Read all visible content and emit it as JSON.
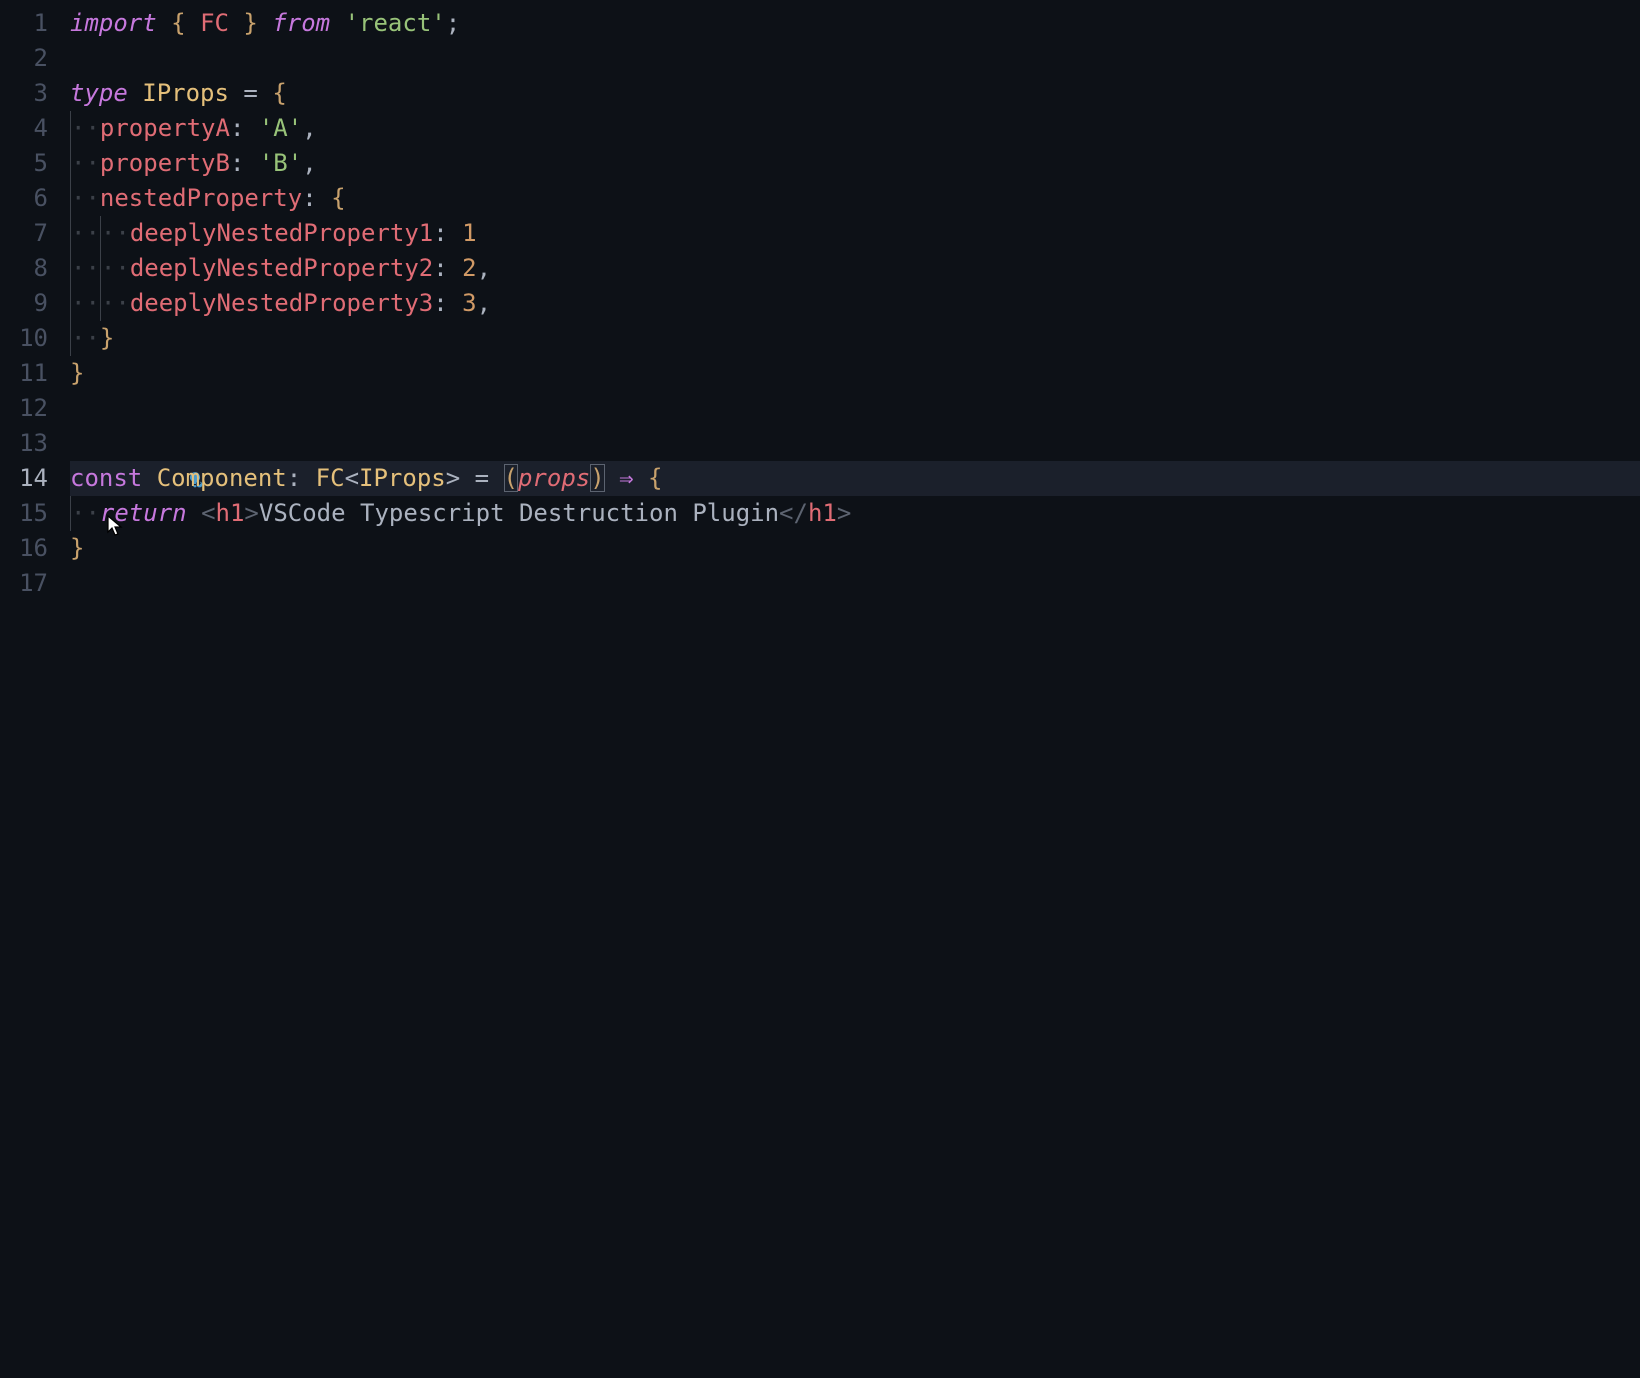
{
  "editor": {
    "lineNumbers": [
      "1",
      "2",
      "3",
      "4",
      "5",
      "6",
      "7",
      "8",
      "9",
      "10",
      "11",
      "12",
      "13",
      "14",
      "15",
      "16",
      "17"
    ],
    "activeLine": 14,
    "lightbulbLine": 13
  },
  "code": {
    "l1": {
      "import": "import",
      "fc": "FC",
      "from": "from",
      "react": "'react'"
    },
    "l3": {
      "type": "type",
      "iprops": "IProps",
      "eq": "="
    },
    "l4": {
      "propA": "propertyA",
      "valA": "'A'"
    },
    "l5": {
      "propB": "propertyB",
      "valB": "'B'"
    },
    "l6": {
      "nested": "nestedProperty"
    },
    "l7": {
      "dn1": "deeplyNestedProperty1",
      "v1": "1"
    },
    "l8": {
      "dn2": "deeplyNestedProperty2",
      "v2": "2"
    },
    "l9": {
      "dn3": "deeplyNestedProperty3",
      "v3": "3"
    },
    "l14": {
      "const": "const",
      "component": "Component",
      "fc": "FC",
      "iprops": "IProps",
      "eq": "=",
      "props": "props",
      "arrow": "⇒"
    },
    "l15": {
      "return": "return",
      "h1": "h1",
      "text": "VSCode Typescript Destruction Plugin"
    }
  },
  "punct": {
    "lbrace": "{",
    "rbrace": "}",
    "lparen": "(",
    "rparen": ")",
    "lt": "<",
    "gt": ">",
    "colon": ":",
    "comma": ",",
    "semi": ";",
    "slash": "/",
    "dot": "·"
  }
}
